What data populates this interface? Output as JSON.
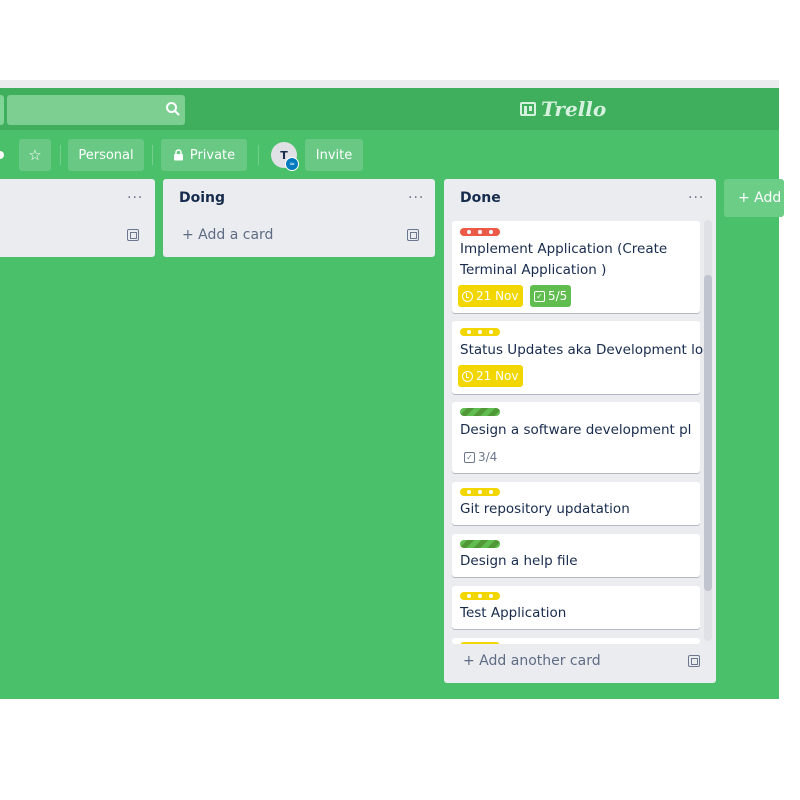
{
  "app": {
    "name": "Trello"
  },
  "board_bar": {
    "star_label": "☆",
    "personal_label": "Personal",
    "private_label": "Private",
    "avatar_initial": "T",
    "invite_label": "Invite"
  },
  "lists": [
    {
      "title": "",
      "menu": "···",
      "add_card": ""
    },
    {
      "title": "Doing",
      "menu": "···",
      "add_card": "+ Add a card"
    },
    {
      "title": "Done",
      "menu": "···",
      "add_card": "+ Add another card",
      "cards": [
        {
          "text": "Implement Application (Create Terminal Application )",
          "label_color": "#eb5a46",
          "due": "21 Nov",
          "due_color": "#f2d600",
          "checklist": "5/5",
          "checklist_color": "#61bd4f"
        },
        {
          "text": "Status Updates aka Development log",
          "label_color": "#f2d600",
          "due": "21 Nov",
          "due_color": "#f2d600"
        },
        {
          "text": "Design a software development pl",
          "label_color": "#61bd4f",
          "checklist": "3/4"
        },
        {
          "text": "Git repository updatation",
          "label_color": "#f2d600"
        },
        {
          "text": "Design a help file",
          "label_color": "#61bd4f"
        },
        {
          "text": "Test Application",
          "label_color": "#f2d600"
        }
      ]
    }
  ],
  "add_list_label": "+ Add another list",
  "colors": {
    "board": "#4ac06b",
    "header": "#3fae5d",
    "list_bg": "#ebecf0"
  }
}
